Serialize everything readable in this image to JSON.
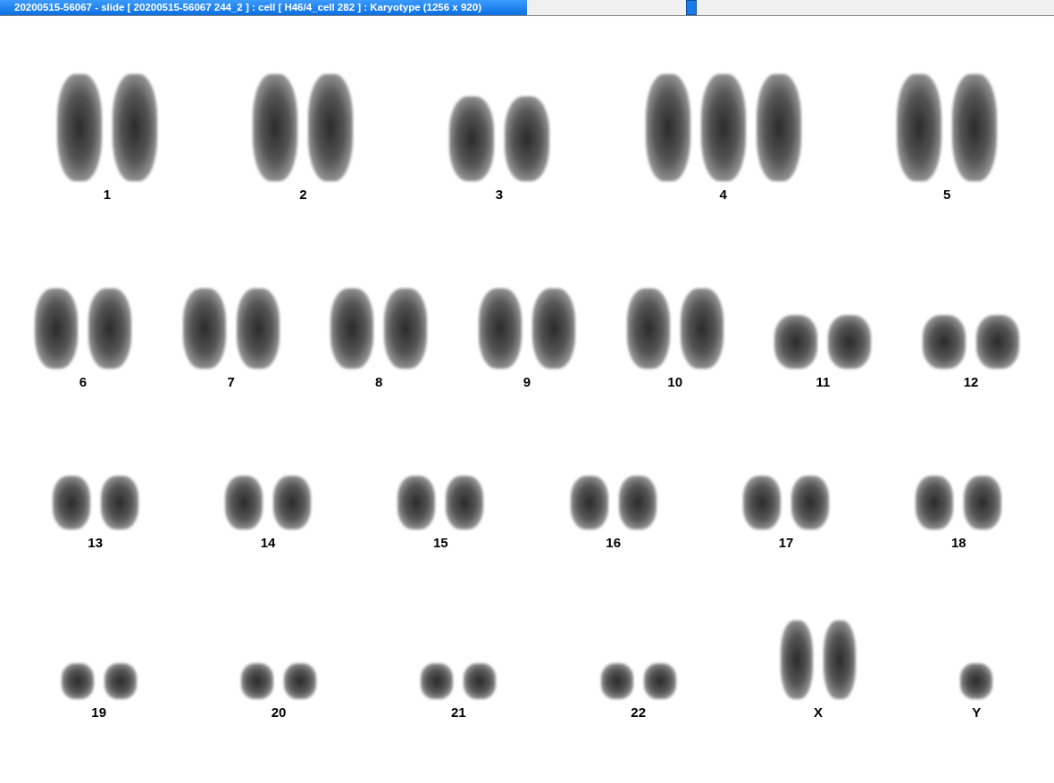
{
  "window": {
    "title": "20200515-56067 - slide [ 20200515-56067 244_2 ] : cell [ H46/4_cell 282 ] : Karyotype  (1256 x 920)"
  },
  "karyotype_rows": [
    {
      "items": [
        {
          "label": "1",
          "kind": "pair"
        },
        {
          "label": "2",
          "kind": "pair"
        },
        {
          "label": "3",
          "kind": "pair"
        },
        {
          "label": "4",
          "kind": "triple"
        },
        {
          "label": "5",
          "kind": "pair"
        }
      ]
    },
    {
      "items": [
        {
          "label": "6",
          "kind": "pair"
        },
        {
          "label": "7",
          "kind": "pair"
        },
        {
          "label": "8",
          "kind": "pair"
        },
        {
          "label": "9",
          "kind": "pair"
        },
        {
          "label": "10",
          "kind": "pair"
        },
        {
          "label": "11",
          "kind": "pair"
        },
        {
          "label": "12",
          "kind": "pair"
        }
      ]
    },
    {
      "items": [
        {
          "label": "13",
          "kind": "pair"
        },
        {
          "label": "14",
          "kind": "pair"
        },
        {
          "label": "15",
          "kind": "pair"
        },
        {
          "label": "16",
          "kind": "pair"
        },
        {
          "label": "17",
          "kind": "pair"
        },
        {
          "label": "18",
          "kind": "pair"
        }
      ]
    },
    {
      "items": [
        {
          "label": "19",
          "kind": "pair"
        },
        {
          "label": "20",
          "kind": "pair"
        },
        {
          "label": "21",
          "kind": "pair"
        },
        {
          "label": "22",
          "kind": "pair"
        },
        {
          "label": "X",
          "kind": "pair"
        },
        {
          "label": "Y",
          "kind": "single"
        }
      ]
    }
  ]
}
